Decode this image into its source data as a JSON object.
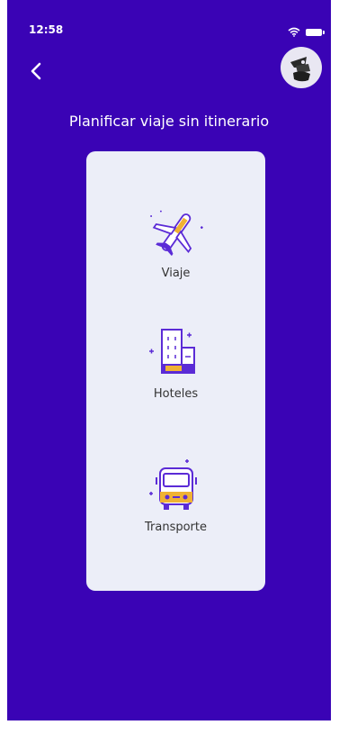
{
  "status_bar": {
    "time": "12:58"
  },
  "header": {
    "back_icon": "chevron-left-icon",
    "avatar_icon": "user-avatar"
  },
  "page": {
    "title": "Planificar viaje sin itinerario"
  },
  "options": [
    {
      "label": "Viaje",
      "icon": "airplane-icon"
    },
    {
      "label": "Hoteles",
      "icon": "hotel-building-icon"
    },
    {
      "label": "Transporte",
      "icon": "bus-icon"
    }
  ],
  "colors": {
    "background": "#3a03b5",
    "card": "#eceef8",
    "accent_purple": "#5b2bd6",
    "accent_yellow": "#f0b233"
  }
}
